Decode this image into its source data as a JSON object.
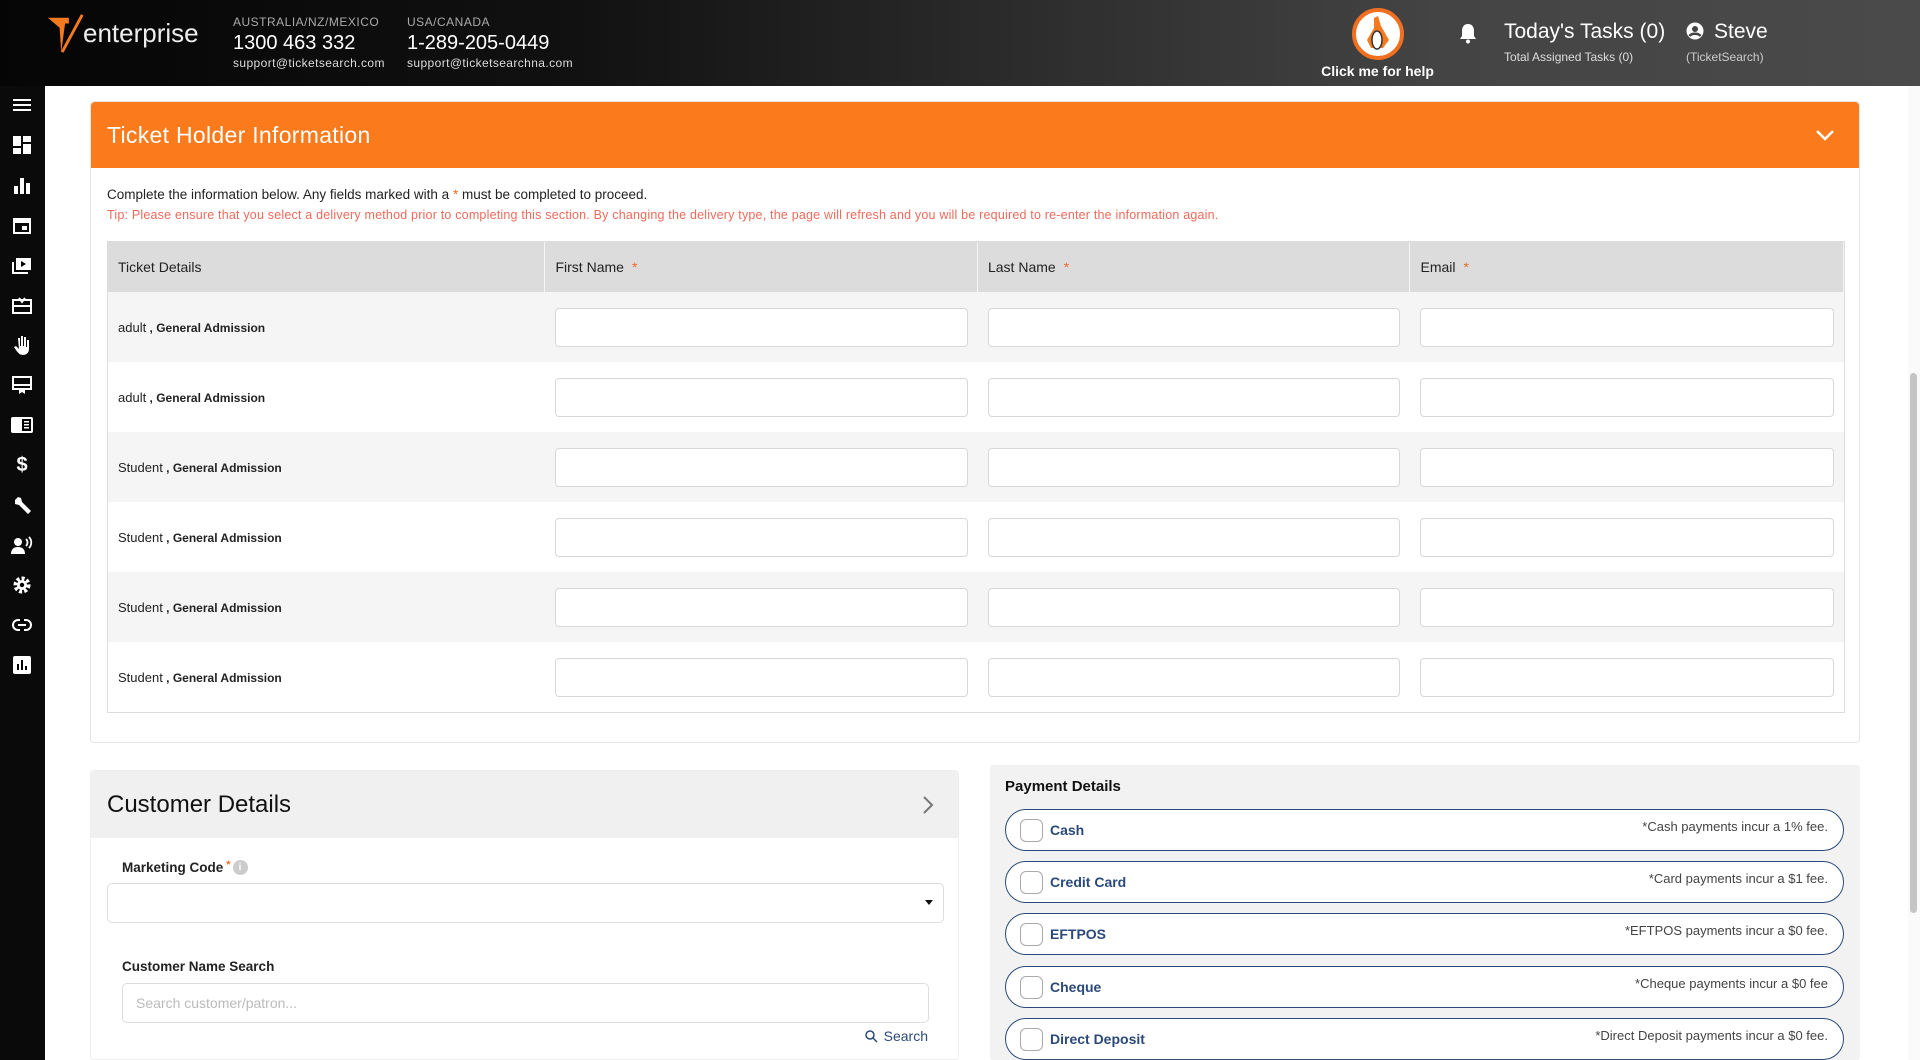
{
  "header": {
    "logo_text": "enterprise",
    "contacts": [
      {
        "region": "AUSTRALIA/NZ/MEXICO",
        "phone": "1300 463 332",
        "email": "support@ticketsearch.com"
      },
      {
        "region": "USA/CANADA",
        "phone": "1-289-205-0449",
        "email": "support@ticketsearchna.com"
      }
    ],
    "help_label": "Click me for help",
    "tasks_title": "Today's Tasks (0)",
    "tasks_sub": "Total Assigned Tasks (0)",
    "user_name": "Steve",
    "user_org": "(TicketSearch)"
  },
  "sidebar": {
    "icons": [
      "menu-icon",
      "dashboard-icon",
      "bar-chart-icon",
      "calendar-icon",
      "media-icon",
      "gift-card-icon",
      "hand-icon",
      "display-icon",
      "reader-icon",
      "dollar-icon",
      "wrench-icon",
      "voice-user-icon",
      "gear-icon",
      "link-icon",
      "report-icon"
    ]
  },
  "ticket_holder": {
    "title": "Ticket Holder Information",
    "intro_before": "Complete the information below. Any fields marked with a ",
    "intro_star": "*",
    "intro_after": " must be completed to proceed.",
    "tip": "Tip: Please ensure that you select a delivery method prior to completing this section. By changing the delivery type, the page will refresh and you will be required to re-enter the information again.",
    "columns": [
      "Ticket Details",
      "First Name",
      "Last Name",
      "Email"
    ],
    "required_mark": "*",
    "rows": [
      {
        "type": "adult",
        "sep": " , ",
        "admission": "General Admission"
      },
      {
        "type": "adult",
        "sep": " , ",
        "admission": "General Admission"
      },
      {
        "type": "Student",
        "sep": " , ",
        "admission": "General Admission"
      },
      {
        "type": "Student",
        "sep": " , ",
        "admission": "General Admission"
      },
      {
        "type": "Student",
        "sep": " , ",
        "admission": "General Admission"
      },
      {
        "type": "Student",
        "sep": " , ",
        "admission": "General Admission"
      }
    ]
  },
  "customer": {
    "title": "Customer Details",
    "marketing_label": "Marketing Code",
    "marketing_value": "",
    "required_mark": "*",
    "search_label": "Customer Name Search",
    "search_placeholder": "Search customer/patron...",
    "search_button": "Search"
  },
  "payment": {
    "title": "Payment Details",
    "options": [
      {
        "name": "Cash",
        "fee": "*Cash payments incur a 1% fee."
      },
      {
        "name": "Credit Card",
        "fee": "*Card payments incur a $1 fee."
      },
      {
        "name": "EFTPOS",
        "fee": "*EFTPOS payments incur a $0 fee."
      },
      {
        "name": "Cheque",
        "fee": "*Cheque payments incur a $0 fee"
      },
      {
        "name": "Direct Deposit",
        "fee": "*Direct Deposit payments incur a $0 fee."
      }
    ]
  },
  "colors": {
    "accent": "#fb7a1c",
    "navy": "#2b4a7a",
    "tip": "#f06a5a"
  }
}
